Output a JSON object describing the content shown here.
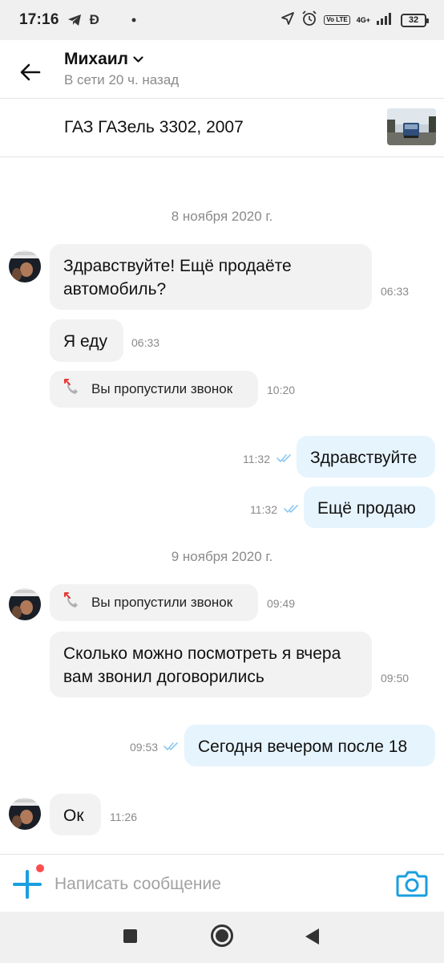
{
  "status_bar": {
    "time": "17:16",
    "left_icons": [
      "telegram-icon",
      "d-app-icon",
      "notification-dot-icon"
    ],
    "volte_label": "Vo LTE",
    "network_label": "4G+",
    "battery": "32"
  },
  "header": {
    "contact_name": "Михаил",
    "contact_status": "В сети 20 ч. назад"
  },
  "listing": {
    "title": "ГАЗ ГАЗель 3302, 2007"
  },
  "messages": {
    "date1": "8 ноября 2020 г.",
    "m1_text": "Здравствуйте! Ещё продаёте автомобиль?",
    "m1_time": "06:33",
    "m2_text": "Я еду",
    "m2_time": "06:33",
    "call1_text": "Вы пропустили звонок",
    "call1_time": "10:20",
    "m3_text": "Здравствуйте",
    "m3_time": "11:32",
    "m4_text": "Ещё продаю",
    "m4_time": "11:32",
    "date2": "9 ноября 2020 г.",
    "call2_text": "Вы пропустили звонок",
    "call2_time": "09:49",
    "m5_text": "Сколько можно посмотреть я вчера вам звонил  договорились",
    "m5_time": "09:50",
    "m6_text": "Сегодня вечером после 18",
    "m6_time": "09:53",
    "m7_text": "Ок",
    "m7_time": "11:26"
  },
  "input": {
    "placeholder": "Написать сообщение",
    "value": ""
  },
  "colors": {
    "accent": "#1a9fe0",
    "incoming_bubble": "#f2f2f2",
    "outgoing_bubble": "#e6f4fe",
    "read_ticks": "#8cc8ee",
    "missed_call": "#e53935"
  }
}
